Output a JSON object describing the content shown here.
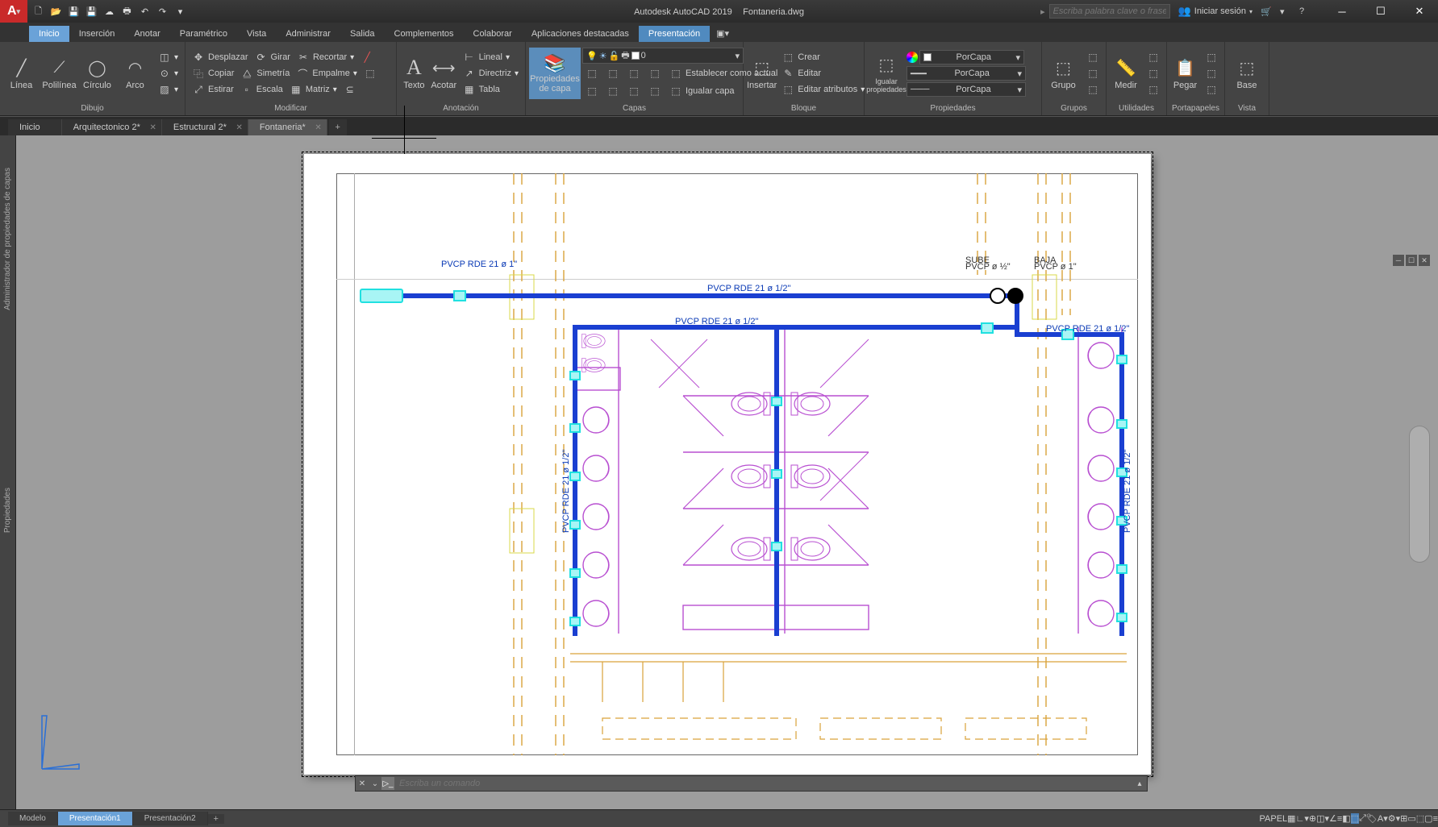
{
  "title": {
    "app": "Autodesk AutoCAD 2019",
    "file": "Fontaneria.dwg"
  },
  "search_placeholder": "Escriba palabra clave o frase",
  "signin": "Iniciar sesión",
  "qat_icons": [
    "new-icon",
    "open-icon",
    "save-icon",
    "saveas-icon",
    "plot-icon",
    "undo-icon",
    "redo-icon",
    "export-icon",
    "cloud-icon"
  ],
  "tabs": [
    "Inicio",
    "Inserción",
    "Anotar",
    "Paramétrico",
    "Vista",
    "Administrar",
    "Salida",
    "Complementos",
    "Colaborar",
    "Aplicaciones destacadas",
    "Presentación"
  ],
  "active_tab": "Inicio",
  "active_context_tab": "Presentación",
  "ribbon": {
    "dibujo": {
      "label": "Dibujo",
      "items": [
        "Línea",
        "Polilínea",
        "Círculo",
        "Arco"
      ]
    },
    "modificar": {
      "label": "Modificar",
      "row1": [
        "Desplazar",
        "Girar",
        "Recortar"
      ],
      "row2": [
        "Copiar",
        "Simetría",
        "Empalme"
      ],
      "row3": [
        "Estirar",
        "Escala",
        "Matriz"
      ]
    },
    "anotacion": {
      "label": "Anotación",
      "texto": "Texto",
      "acotar": "Acotar",
      "lineal": "Lineal",
      "directriz": "Directriz",
      "tabla": "Tabla"
    },
    "capas": {
      "label": "Capas",
      "prop": "Propiedades de capa",
      "current_layer": "0",
      "match": "Establecer como actual",
      "iso": "Igualar capa"
    },
    "bloque": {
      "label": "Bloque",
      "insertar": "Insertar",
      "crear": "Crear",
      "editar": "Editar",
      "attr": "Editar atributos"
    },
    "propiedades": {
      "label": "Propiedades",
      "igualar": "Igualar propiedades",
      "color": "PorCapa",
      "ltype": "PorCapa",
      "lweight": "PorCapa"
    },
    "grupos": {
      "label": "Grupos",
      "grupo": "Grupo"
    },
    "utilidades": {
      "label": "Utilidades",
      "medir": "Medir"
    },
    "portapapeles": {
      "label": "Portapapeles",
      "pegar": "Pegar"
    },
    "vista": {
      "label": "Vista",
      "base": "Base"
    }
  },
  "doc_tabs": [
    {
      "name": "Inicio",
      "active": false,
      "close": false
    },
    {
      "name": "Arquitectonico 2*",
      "active": false,
      "close": true
    },
    {
      "name": "Estructural 2*",
      "active": false,
      "close": true
    },
    {
      "name": "Fontaneria*",
      "active": true,
      "close": true
    }
  ],
  "side_panels": [
    "Administrador de propiedades de capas",
    "Propiedades"
  ],
  "cmd_placeholder": "Escriba un comando",
  "layout_tabs": [
    {
      "name": "Modelo",
      "active": false
    },
    {
      "name": "Presentación1",
      "active": true
    },
    {
      "name": "Presentación2",
      "active": false
    }
  ],
  "status": {
    "papel": "PAPEL"
  },
  "drawing_labels": {
    "main": "PVCP RDE 21 ø 1/2\"",
    "branch": "PVCP RDE 21 ø 1/2\"",
    "left": "PVCP RDE 21 ø 1\"",
    "sube": "SUBE",
    "pvcp": "PVCP ø ½\"",
    "baja": "BAJA",
    "pvcp2": "PVCP ø 1\"",
    "side": "PVCP RDE 21 ø 1/2\"",
    "branch2": "PVCP RDE 21 ø 1/2\""
  }
}
